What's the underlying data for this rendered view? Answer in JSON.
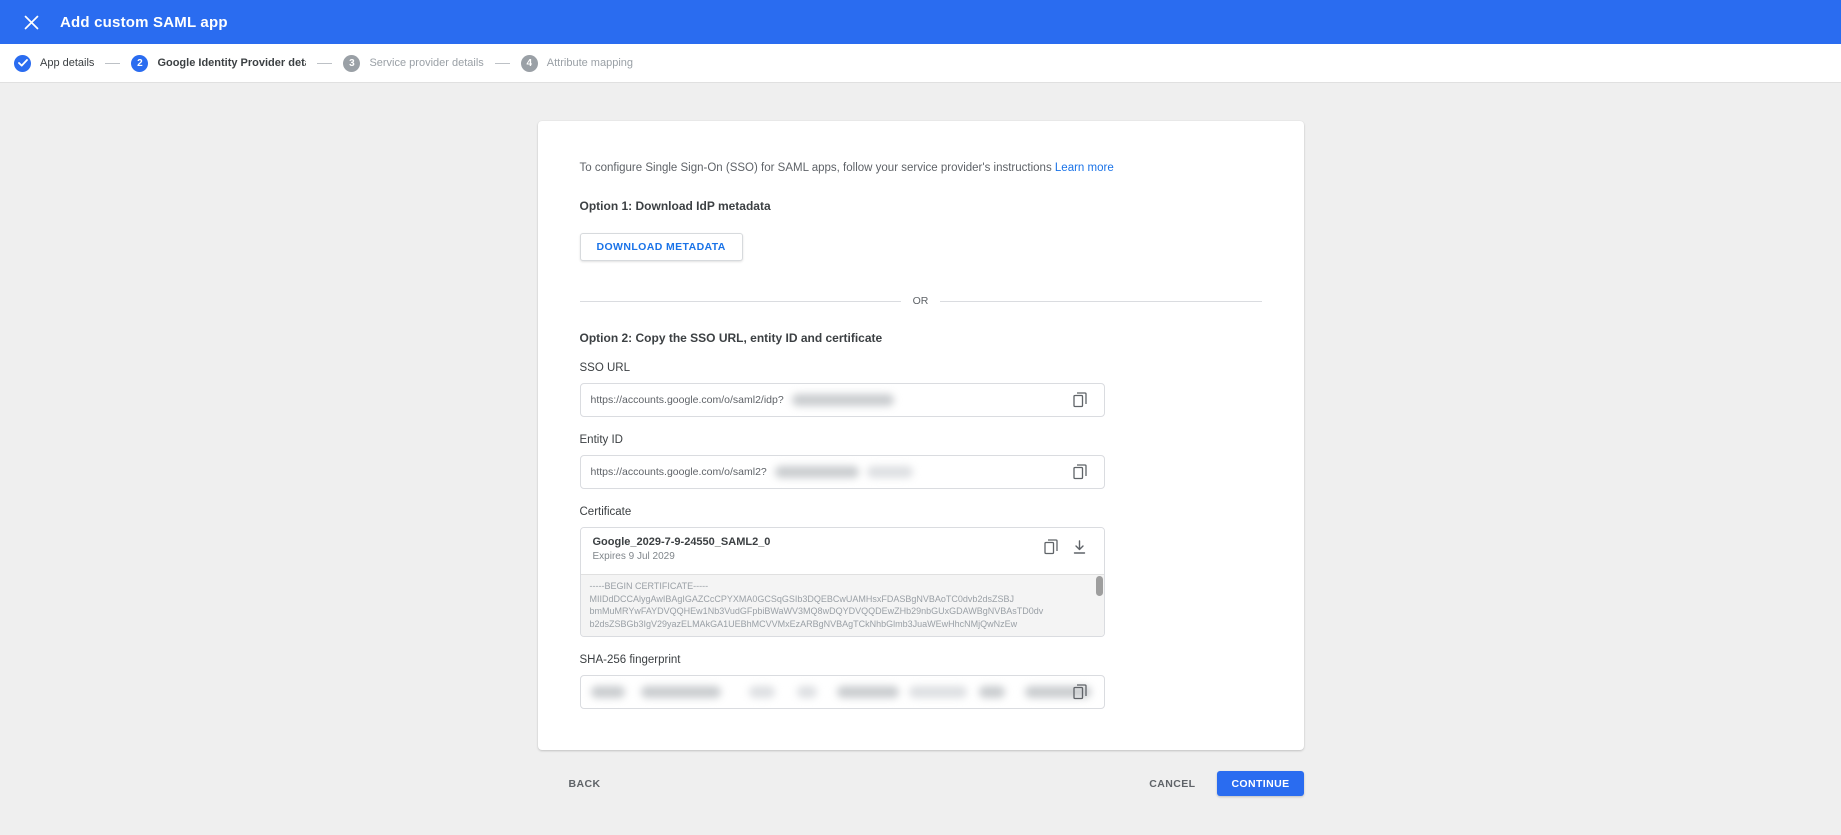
{
  "header": {
    "title": "Add custom SAML app"
  },
  "stepper": {
    "steps": [
      {
        "num": "1",
        "label": "App details",
        "state": "complete"
      },
      {
        "num": "2",
        "label": "Google Identity Provider details",
        "state": "active"
      },
      {
        "num": "3",
        "label": "Service provider details",
        "state": "upcoming"
      },
      {
        "num": "4",
        "label": "Attribute mapping",
        "state": "upcoming"
      }
    ]
  },
  "main": {
    "intro_text": "To configure Single Sign-On (SSO) for SAML apps, follow your service provider's instructions",
    "learn_more_label": "Learn more",
    "option1_heading": "Option 1: Download IdP metadata",
    "download_button_label": "DOWNLOAD METADATA",
    "divider_label": "OR",
    "option2_heading": "Option 2: Copy the SSO URL, entity ID and certificate",
    "sso_url": {
      "label": "SSO URL",
      "value": "https://accounts.google.com/o/saml2/idp?"
    },
    "entity_id": {
      "label": "Entity ID",
      "value": "https://accounts.google.com/o/saml2?"
    },
    "certificate": {
      "label": "Certificate",
      "name": "Google_2029-7-9-24550_SAML2_0",
      "expires": "Expires 9 Jul 2029",
      "body_lines": [
        "-----BEGIN CERTIFICATE-----",
        "MIIDdDCCAlygAwIBAgIGAZCcCPYXMA0GCSqGSIb3DQEBCwUAMHsxFDASBgNVBAoTC0dvb2dsZSBJ",
        "bmMuMRYwFAYDVQQHEw1Nb3VudGFpbiBWaWV3MQ8wDQYDVQQDEwZHb29nbGUxGDAWBgNVBAsTD0dv",
        "b2dsZSBGb3IgV29yazELMAkGA1UEBhMCVVMxEzARBgNVBAgTCkNhbGlmb3JuaWEwHhcNMjQwNzEw"
      ]
    },
    "sha_fingerprint": {
      "label": "SHA-256 fingerprint"
    }
  },
  "footer": {
    "back_label": "BACK",
    "cancel_label": "CANCEL",
    "continue_label": "CONTINUE"
  },
  "colors": {
    "appbar_blue": "#2a6cf0",
    "link_blue": "#1a73e8",
    "continue_blue": "#2a6cf0",
    "inactive_step_gray": "#9aa0a6",
    "page_background": "#efefef"
  }
}
